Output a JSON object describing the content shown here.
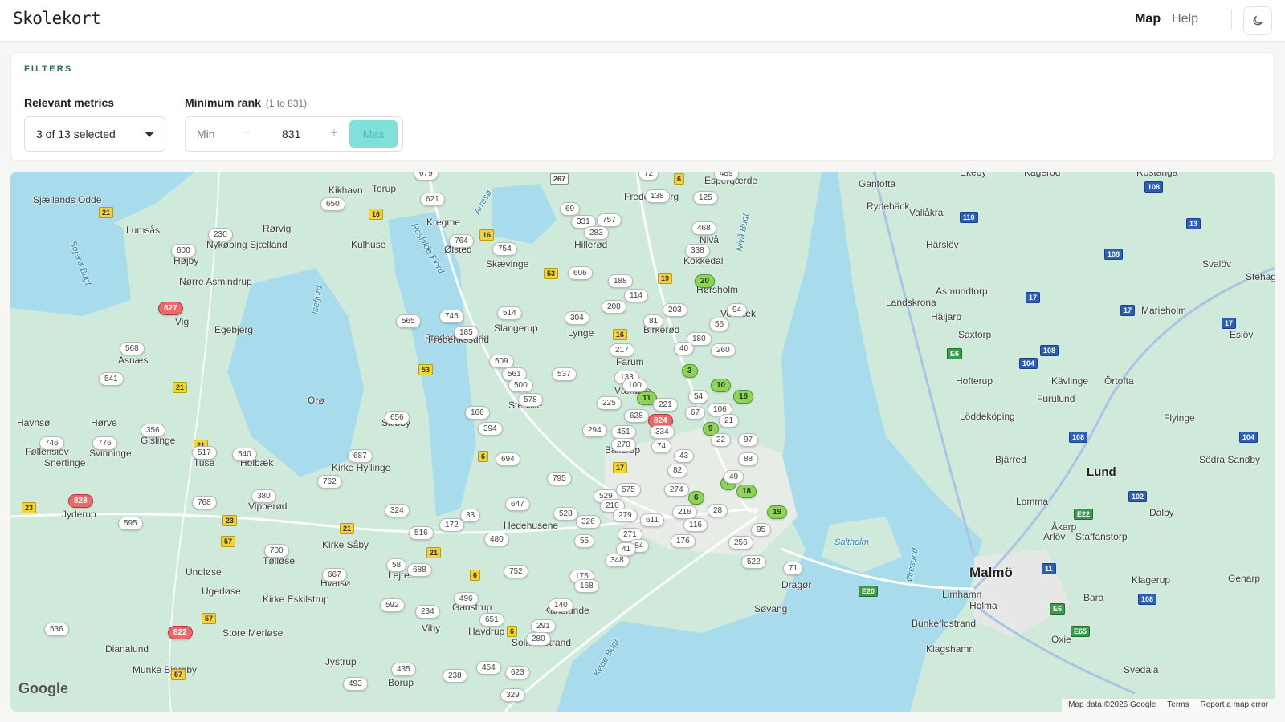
{
  "app": {
    "brand": "Skolekort",
    "nav": {
      "map": "Map",
      "help": "Help"
    }
  },
  "filters": {
    "title": "FILTERS",
    "metrics": {
      "label": "Relevant metrics",
      "value": "3 of 13 selected"
    },
    "rank": {
      "label": "Minimum rank",
      "hint": "(1 to 831)",
      "min_label": "Min",
      "minus": "−",
      "value": "831",
      "plus": "+",
      "max_label": "Max"
    }
  },
  "map": {
    "places": [
      "Sjællands Odde",
      "Lumsås",
      "Nykøbing Sjælland",
      "Højby",
      "Nørre Asmindrup",
      "Vig",
      "Egebjerg",
      "Asnæs",
      "Hørve",
      "Havnsø",
      "Føllenslev",
      "Svinninge",
      "Gislinge",
      "Snertinge",
      "Jyderup",
      "Tuse",
      "Holbæk",
      "Vipperød",
      "Orø",
      "Kirke Hyllinge",
      "Skibby",
      "Undløse",
      "Ugerløse",
      "Tølløse",
      "Kirke Eskilstrup",
      "Store Merløse",
      "Dianalund",
      "Munke Bjergby",
      "Stenlille",
      "Kirke Såby",
      "Hvalsø",
      "Lejre",
      "Gadstrup",
      "Viby",
      "Havdrup",
      "Solrød Strand",
      "Jystrup",
      "Borup",
      "Kikhavn",
      "Torup",
      "Rørvig",
      "Kulhuse",
      "Kregme",
      "Ølsted",
      "Frederiksværk",
      "Skævinge",
      "Hillerød",
      "Slangerup",
      "Frederikssund",
      "Lynge",
      "Farum",
      "Birkerød",
      "Værløse",
      "Ballerup",
      "Hedehusene",
      "Karlslunde",
      "Hørsholm",
      "Nivå",
      "Kokkedal",
      "Espergærde",
      "Fredensborg",
      "Vedbæk",
      "Dragør",
      "Søvang",
      "Saltholm",
      "Malmö",
      "Lund",
      "Limhamn",
      "Holma",
      "Bunkeflostrand",
      "Klagshamn",
      "Oxie",
      "Svedala",
      "Staffanstorp",
      "Åkarp",
      "Arlöv",
      "Lomma",
      "Bjärred",
      "Dalby",
      "Södra Sandby",
      "Genarp",
      "Klagerup",
      "Bara",
      "Hofterup",
      "Löddeköping",
      "Flyinge",
      "Furulund",
      "Kävlinge",
      "Örtofta",
      "Landskrona",
      "Häljarp",
      "Saxtorp",
      "Eslöv",
      "Marieholm",
      "Asmundtorp",
      "Svalöv",
      "Stehag",
      "Härslöv",
      "Vallåkra",
      "Rydebäck",
      "Gantofta",
      "Ekeby",
      "Kågeröd",
      "Rostånga"
    ],
    "water_labels": [
      "Isefjord",
      "Roskilde Fjord",
      "Arresø",
      "Sejerø Bugt",
      "Nivå Bugt",
      "Køge Bugt",
      "Øresund"
    ],
    "markers": [
      {
        "v": "827",
        "kind": "red"
      },
      {
        "v": "828",
        "kind": "red"
      },
      {
        "v": "822",
        "kind": "red"
      },
      {
        "v": "824",
        "kind": "red"
      },
      {
        "v": "20",
        "kind": "green"
      },
      {
        "v": "3",
        "kind": "green"
      },
      {
        "v": "10",
        "kind": "green"
      },
      {
        "v": "16",
        "kind": "green"
      },
      {
        "v": "11",
        "kind": "green"
      },
      {
        "v": "9",
        "kind": "green"
      },
      {
        "v": "7",
        "kind": "green"
      },
      {
        "v": "18",
        "kind": "green"
      },
      {
        "v": "6",
        "kind": "green"
      },
      {
        "v": "19",
        "kind": "green"
      },
      {
        "v": "679"
      },
      {
        "v": "650"
      },
      {
        "v": "621"
      },
      {
        "v": "230"
      },
      {
        "v": "600"
      },
      {
        "v": "568"
      },
      {
        "v": "541"
      },
      {
        "v": "746"
      },
      {
        "v": "776"
      },
      {
        "v": "356"
      },
      {
        "v": "517"
      },
      {
        "v": "540"
      },
      {
        "v": "768"
      },
      {
        "v": "380"
      },
      {
        "v": "595"
      },
      {
        "v": "700"
      },
      {
        "v": "667"
      },
      {
        "v": "536"
      },
      {
        "v": "762"
      },
      {
        "v": "687"
      },
      {
        "v": "656"
      },
      {
        "v": "565"
      },
      {
        "v": "745"
      },
      {
        "v": "185"
      },
      {
        "v": "514"
      },
      {
        "v": "764"
      },
      {
        "v": "754"
      },
      {
        "v": "509"
      },
      {
        "v": "561"
      },
      {
        "v": "500"
      },
      {
        "v": "578"
      },
      {
        "v": "166"
      },
      {
        "v": "394"
      },
      {
        "v": "694"
      },
      {
        "v": "537"
      },
      {
        "v": "324"
      },
      {
        "v": "516"
      },
      {
        "v": "172"
      },
      {
        "v": "33"
      },
      {
        "v": "480"
      },
      {
        "v": "647"
      },
      {
        "v": "58"
      },
      {
        "v": "688"
      },
      {
        "v": "592"
      },
      {
        "v": "234"
      },
      {
        "v": "496"
      },
      {
        "v": "651"
      },
      {
        "v": "752"
      },
      {
        "v": "795"
      },
      {
        "v": "435"
      },
      {
        "v": "493"
      },
      {
        "v": "238"
      },
      {
        "v": "464"
      },
      {
        "v": "623"
      },
      {
        "v": "329"
      },
      {
        "v": "291"
      },
      {
        "v": "280"
      },
      {
        "v": "69"
      },
      {
        "v": "331"
      },
      {
        "v": "757"
      },
      {
        "v": "283"
      },
      {
        "v": "72"
      },
      {
        "v": "138"
      },
      {
        "v": "125"
      },
      {
        "v": "489"
      },
      {
        "v": "468"
      },
      {
        "v": "338"
      },
      {
        "v": "606"
      },
      {
        "v": "304"
      },
      {
        "v": "188"
      },
      {
        "v": "114"
      },
      {
        "v": "208"
      },
      {
        "v": "203"
      },
      {
        "v": "94"
      },
      {
        "v": "81"
      },
      {
        "v": "56"
      },
      {
        "v": "180"
      },
      {
        "v": "40"
      },
      {
        "v": "260"
      },
      {
        "v": "217"
      },
      {
        "v": "133"
      },
      {
        "v": "100"
      },
      {
        "v": "225"
      },
      {
        "v": "221"
      },
      {
        "v": "54"
      },
      {
        "v": "106"
      },
      {
        "v": "67"
      },
      {
        "v": "628"
      },
      {
        "v": "294"
      },
      {
        "v": "451"
      },
      {
        "v": "334"
      },
      {
        "v": "21"
      },
      {
        "v": "22"
      },
      {
        "v": "97"
      },
      {
        "v": "270"
      },
      {
        "v": "74"
      },
      {
        "v": "43"
      },
      {
        "v": "88"
      },
      {
        "v": "529"
      },
      {
        "v": "575"
      },
      {
        "v": "274"
      },
      {
        "v": "210"
      },
      {
        "v": "528"
      },
      {
        "v": "326"
      },
      {
        "v": "279"
      },
      {
        "v": "611"
      },
      {
        "v": "216"
      },
      {
        "v": "28"
      },
      {
        "v": "116"
      },
      {
        "v": "176"
      },
      {
        "v": "271"
      },
      {
        "v": "55"
      },
      {
        "v": "84"
      },
      {
        "v": "348"
      },
      {
        "v": "175"
      },
      {
        "v": "168"
      },
      {
        "v": "140"
      },
      {
        "v": "95"
      },
      {
        "v": "256"
      },
      {
        "v": "522"
      },
      {
        "v": "71"
      },
      {
        "v": "41"
      },
      {
        "v": "49"
      },
      {
        "v": "82"
      }
    ],
    "attribution": {
      "logo": "Google",
      "data": "Map data ©2026 Google",
      "terms": "Terms",
      "report": "Report a map error"
    }
  }
}
